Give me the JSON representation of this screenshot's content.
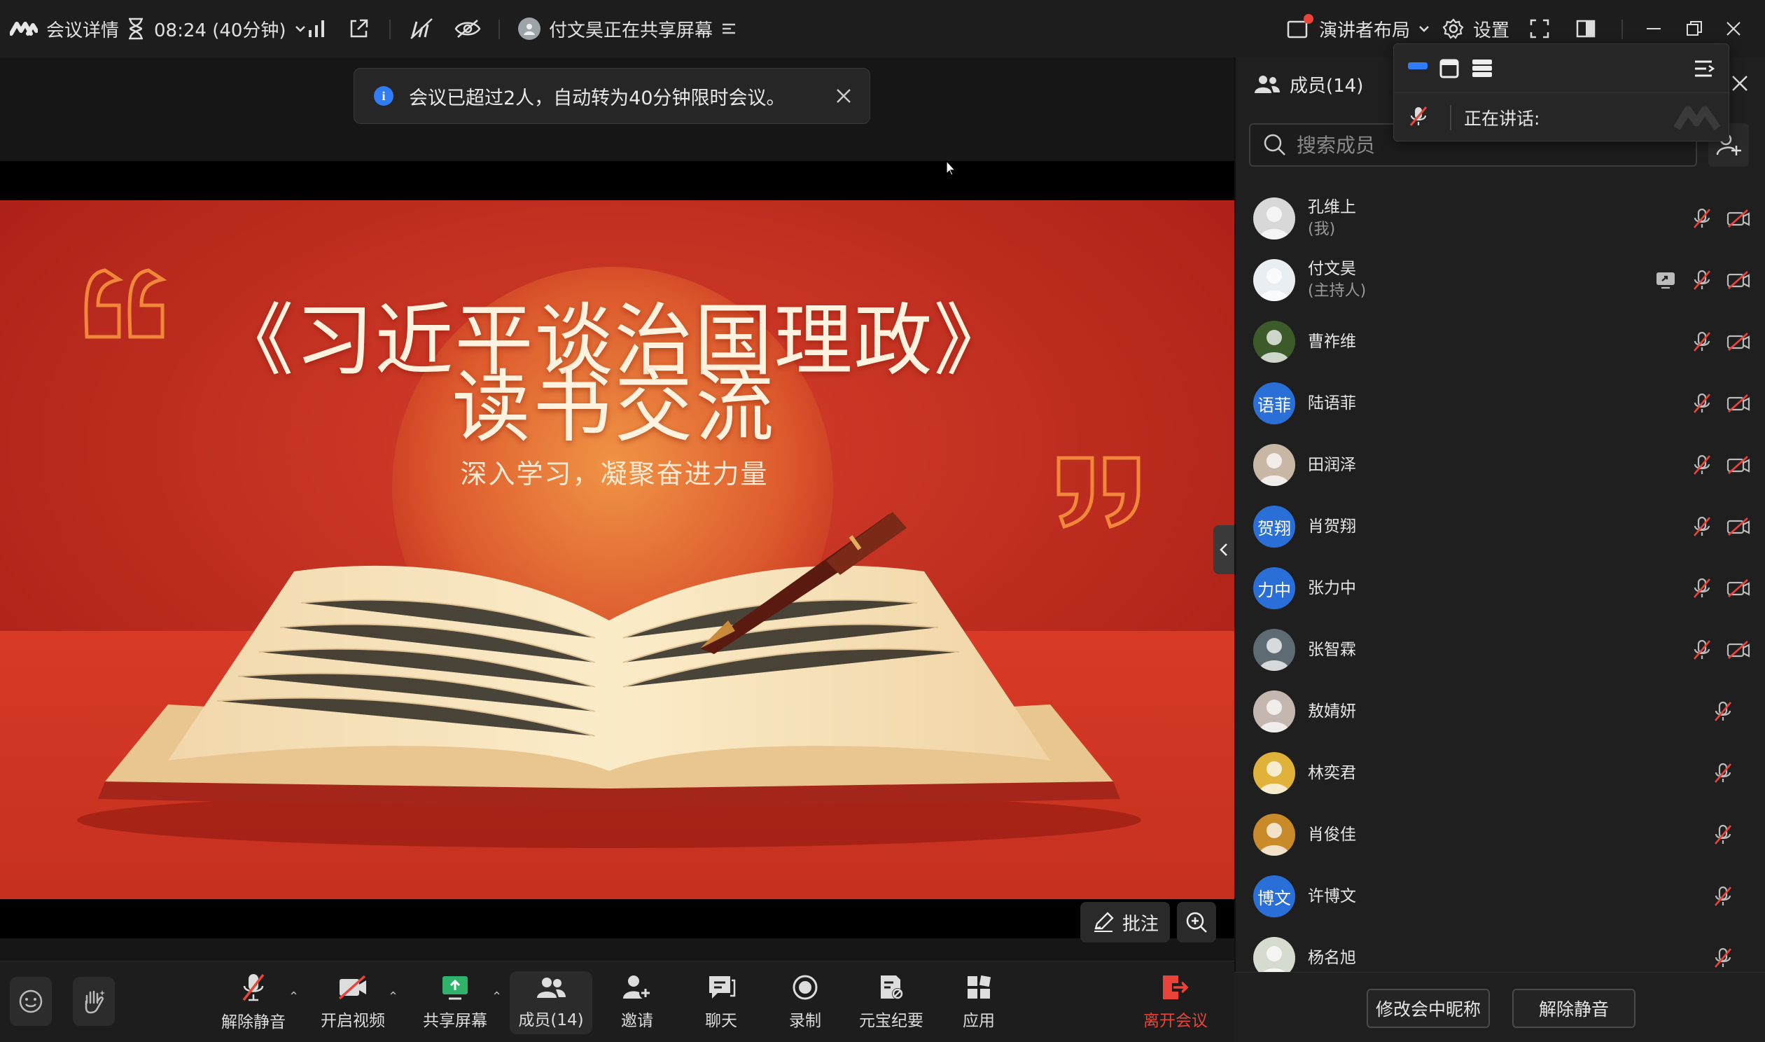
{
  "topbar": {
    "meeting_details": "会议详情",
    "timer": "08:24 (40分钟)",
    "sharing_status": "付文昊正在共享屏幕",
    "layout_label": "演讲者布局",
    "settings_label": "设置"
  },
  "toast": {
    "message": "会议已超过2人，自动转为40分钟限时会议。"
  },
  "slide": {
    "title_line1": "《习近平谈治国理政》",
    "title_line2": "读书交流",
    "subtitle": "深入学习，凝聚奋进力量"
  },
  "stage_tools": {
    "annotate_label": "批注"
  },
  "toolbar": {
    "unmute": "解除静音",
    "start_video": "开启视频",
    "share_screen": "共享屏幕",
    "members": "成员(14)",
    "invite": "邀请",
    "chat": "聊天",
    "record": "录制",
    "ai_minutes": "元宝纪要",
    "apps": "应用",
    "leave": "离开会议"
  },
  "panel": {
    "title": "成员(14)",
    "search_placeholder": "搜索成员",
    "members": [
      {
        "name": "孔维上",
        "sub": "(我)",
        "avatar_text": "",
        "avatar_color": "#d8d8d8",
        "sharing": false,
        "video_icon": true
      },
      {
        "name": "付文昊",
        "sub": "(主持人)",
        "avatar_text": "",
        "avatar_color": "#e9eef2",
        "sharing": true,
        "video_icon": true
      },
      {
        "name": "曹祚维",
        "sub": "",
        "avatar_text": "",
        "avatar_color": "#3d5a2a",
        "sharing": false,
        "video_icon": true
      },
      {
        "name": "陆语菲",
        "sub": "",
        "avatar_text": "语菲",
        "avatar_color": "#2a6fd8",
        "sharing": false,
        "video_icon": true
      },
      {
        "name": "田润泽",
        "sub": "",
        "avatar_text": "",
        "avatar_color": "#c9b7a6",
        "sharing": false,
        "video_icon": true
      },
      {
        "name": "肖贺翔",
        "sub": "",
        "avatar_text": "贺翔",
        "avatar_color": "#2a6fd8",
        "sharing": false,
        "video_icon": true
      },
      {
        "name": "张力中",
        "sub": "",
        "avatar_text": "力中",
        "avatar_color": "#2a6fd8",
        "sharing": false,
        "video_icon": true
      },
      {
        "name": "张智霖",
        "sub": "",
        "avatar_text": "",
        "avatar_color": "#5e6b73",
        "sharing": false,
        "video_icon": true
      },
      {
        "name": "敖婧妍",
        "sub": "",
        "avatar_text": "",
        "avatar_color": "#c4b7b0",
        "sharing": false,
        "video_icon": false
      },
      {
        "name": "林奕君",
        "sub": "",
        "avatar_text": "",
        "avatar_color": "#e0b23a",
        "sharing": false,
        "video_icon": false
      },
      {
        "name": "肖俊佳",
        "sub": "",
        "avatar_text": "",
        "avatar_color": "#c98a2a",
        "sharing": false,
        "video_icon": false
      },
      {
        "name": "许博文",
        "sub": "",
        "avatar_text": "博文",
        "avatar_color": "#2a6fd8",
        "sharing": false,
        "video_icon": false
      },
      {
        "name": "杨名旭",
        "sub": "",
        "avatar_text": "",
        "avatar_color": "#d6dbd0",
        "sharing": false,
        "video_icon": false
      }
    ],
    "rename_button": "修改会中昵称",
    "unmute_button": "解除静音"
  },
  "popup": {
    "speaking_label": "正在讲话:"
  },
  "colors": {
    "leave_red": "#e8443a",
    "accent_blue": "#2a6fd8",
    "slide_red": "#c3271d"
  }
}
